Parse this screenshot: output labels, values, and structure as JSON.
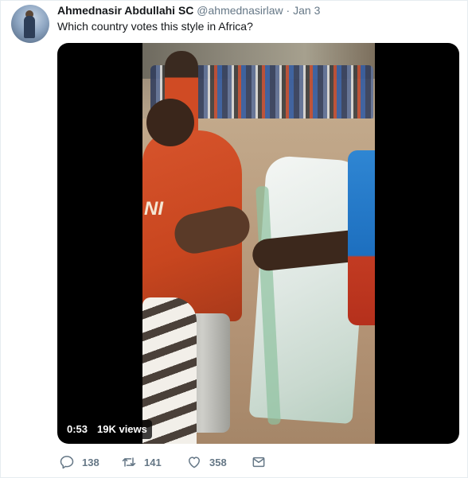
{
  "tweet": {
    "author_name": "Ahmednasir Abdullahi SC",
    "handle": "@ahmednasirlaw",
    "separator": "·",
    "date": "Jan 3",
    "text": "Which country votes this style in Africa?"
  },
  "media": {
    "duration": "0:53",
    "views": "19K views",
    "shirt_logo_text": "NI"
  },
  "actions": {
    "reply_count": "138",
    "retweet_count": "141",
    "like_count": "358"
  },
  "icons": {
    "reply": "reply-icon",
    "retweet": "retweet-icon",
    "like": "heart-icon",
    "message": "envelope-icon"
  },
  "colors": {
    "text": "#14171a",
    "muted": "#657786",
    "border": "#e6ecf0"
  }
}
